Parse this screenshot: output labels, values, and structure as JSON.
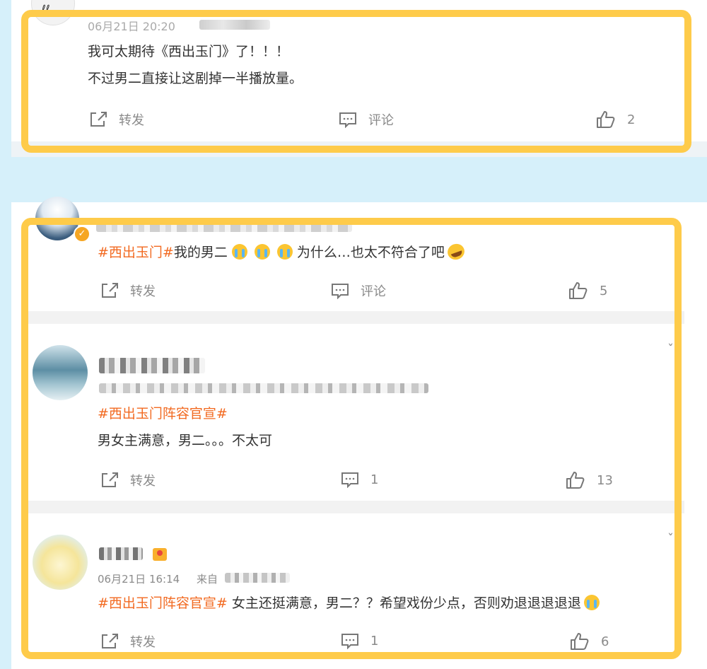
{
  "post1": {
    "time": "06月21日 20:20",
    "line1": "我可太期待《西出玉门》了！！！",
    "line2": "不过男二直接让这剧掉一半播放量。",
    "repost": "转发",
    "comment": "评论",
    "likes": "2"
  },
  "post2": {
    "topic": "#西出玉门#",
    "text": "我的男二",
    "text2": "为什么…也太不符合了吧",
    "repost": "转发",
    "comment": "评论",
    "likes": "5"
  },
  "post3": {
    "topic": "#西出玉门阵容官宣#",
    "text": "男女主满意，男二。。。不太可",
    "repost": "转发",
    "comments": "1",
    "likes": "13"
  },
  "post4": {
    "time": "06月21日 16:14",
    "source_prefix": "来自",
    "topic": "#西出玉门阵容官宣#",
    "text": " 女主还挺满意，男二？？希望戏份少点，否则劝退退退退退",
    "repost": "转发",
    "comments": "1",
    "likes": "6"
  },
  "colors": {
    "highlight": "#fecb4a",
    "topic": "#f26a21",
    "background": "#d6f0fa"
  },
  "icons": [
    "repost-icon",
    "comment-icon",
    "like-icon",
    "crying-emoji-icon",
    "laughing-emoji-icon",
    "verified-badge-icon"
  ]
}
